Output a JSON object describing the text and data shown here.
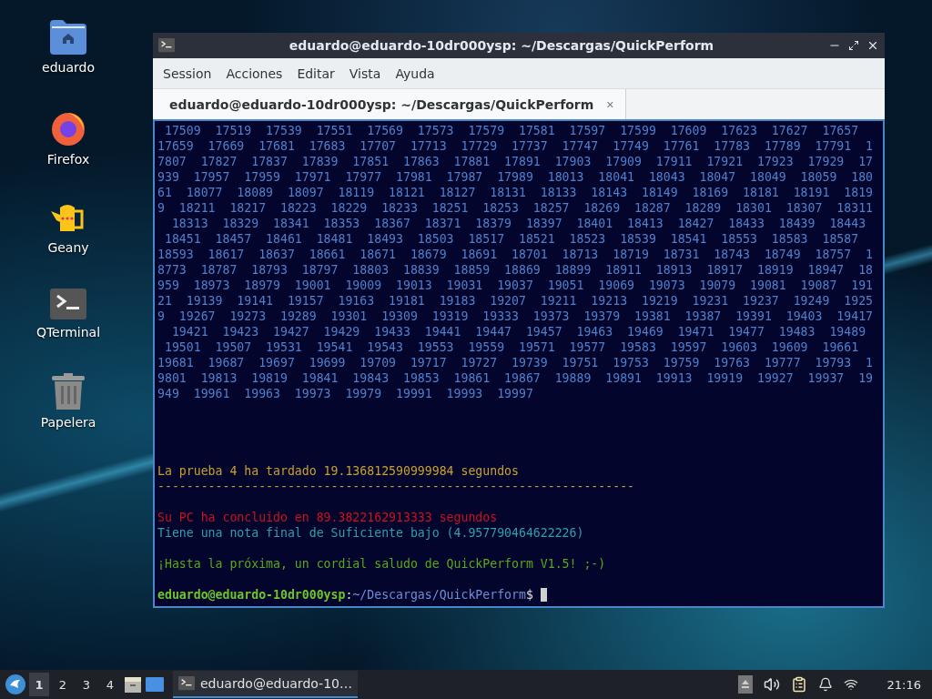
{
  "desktop_icons": [
    {
      "kind": "folder",
      "label": "eduardo"
    },
    {
      "kind": "browser",
      "label": "Firefox"
    },
    {
      "kind": "editor",
      "label": "Geany"
    },
    {
      "kind": "terminal",
      "label": "QTerminal"
    },
    {
      "kind": "trash",
      "label": "Papelera"
    }
  ],
  "window": {
    "title": "eduardo@eduardo-10dr000ysp: ~/Descargas/QuickPerform",
    "menu": [
      "Session",
      "Acciones",
      "Editar",
      "Vista",
      "Ayuda"
    ],
    "tabs": [
      {
        "label": "eduardo@eduardo-10dr000ysp: ~/Descargas/QuickPerform",
        "selected": true,
        "close": "×"
      }
    ],
    "terminal": {
      "output": [
        " 17509  17519  17539  17551  17569  17573  17579  17581  17597  17599  17609  17623  17627  17657",
        "17659  17669  17681  17683  17707  17713  17729  17737  17747  17749  17761  17783  17789  17791  1",
        "7807  17827  17837  17839  17851  17863  17881  17891  17903  17909  17911  17921  17923  17929  17",
        "939  17957  17959  17971  17977  17981  17987  17989  18013  18041  18043  18047  18049  18059  180",
        "61  18077  18089  18097  18119  18121  18127  18131  18133  18143  18149  18169  18181  18191  1819",
        "9  18211  18217  18223  18229  18233  18251  18253  18257  18269  18287  18289  18301  18307  18311",
        "  18313  18329  18341  18353  18367  18371  18379  18397  18401  18413  18427  18433  18439  18443",
        " 18451  18457  18461  18481  18493  18503  18517  18521  18523  18539  18541  18553  18583  18587",
        "18593  18617  18637  18661  18671  18679  18691  18701  18713  18719  18731  18743  18749  18757  1",
        "8773  18787  18793  18797  18803  18839  18859  18869  18899  18911  18913  18917  18919  18947  18",
        "959  18973  18979  19001  19009  19013  19031  19037  19051  19069  19073  19079  19081  19087  191",
        "21  19139  19141  19157  19163  19181  19183  19207  19211  19213  19219  19231  19237  19249  1925",
        "9  19267  19273  19289  19301  19309  19319  19333  19373  19379  19381  19387  19391  19403  19417",
        "  19421  19423  19427  19429  19433  19441  19447  19457  19463  19469  19471  19477  19483  19489",
        " 19501  19507  19531  19541  19543  19553  19559  19571  19577  19583  19597  19603  19609  19661",
        "19681  19687  19697  19699  19709  19717  19727  19739  19751  19753  19759  19763  19777  19793  1",
        "9801  19813  19819  19841  19843  19853  19861  19867  19889  19891  19913  19919  19927  19937  19",
        "949  19961  19963  19973  19979  19991  19993  19997"
      ],
      "messages": [
        {
          "kind": "timing",
          "color": "#c8a032",
          "text": "La prueba 4 ha tardado 19.136812590999984 segundos"
        },
        {
          "kind": "separator",
          "color": "#c8a032",
          "text": "------------------------------------------------------------------"
        },
        {
          "kind": "total",
          "color": "#d0101c",
          "text": "Su PC ha concluido en 89.3822162913333 segundos"
        },
        {
          "kind": "grade",
          "color": "#2f9fb0",
          "text": "Tiene una nota final de Suficiente bajo (4.957790464622226)"
        },
        {
          "kind": "farewell",
          "color": "#58a81e",
          "text": "¡Hasta la próxima, un cordial saludo de QuickPerform V1.5! ;-)"
        }
      ],
      "prompt": {
        "user_host": "eduardo@eduardo-10dr000ysp",
        "separator": ":",
        "path": "~/Descargas/QuickPerform",
        "symbol": "$"
      }
    }
  },
  "taskbar": {
    "workspaces": [
      {
        "label": "1",
        "selected": true
      },
      {
        "label": "2",
        "selected": false
      },
      {
        "label": "3",
        "selected": false
      },
      {
        "label": "4",
        "selected": false
      }
    ],
    "tasks": [
      {
        "label": "eduardo@eduardo-10…",
        "active": true
      }
    ],
    "clock": "21:16"
  }
}
